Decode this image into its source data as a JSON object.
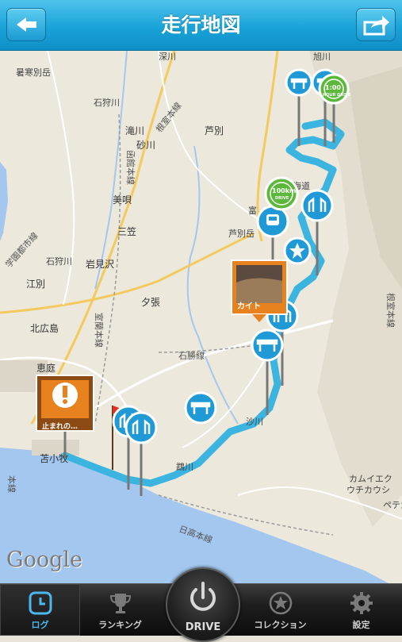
{
  "header": {
    "title": "走行地図",
    "back_icon": "back-arrow-icon",
    "share_icon": "share-icon"
  },
  "map": {
    "place_labels": [
      {
        "id": "fukagawa",
        "text": "深川"
      },
      {
        "id": "asahikawa",
        "text": "旭川"
      },
      {
        "id": "shokanbetsu",
        "text": "暑寒別岳"
      },
      {
        "id": "ishikarigawa",
        "text": "石狩川"
      },
      {
        "id": "takikawa",
        "text": "滝川"
      },
      {
        "id": "sunagawa",
        "text": "砂川"
      },
      {
        "id": "ashibetsu",
        "text": "芦別"
      },
      {
        "id": "bibai",
        "text": "美唄"
      },
      {
        "id": "mikasa",
        "text": "三笠"
      },
      {
        "id": "ashibetsudake",
        "text": "芦別岳"
      },
      {
        "id": "iwamizawa",
        "text": "岩見沢"
      },
      {
        "id": "ishikarigawa2",
        "text": "石狩川"
      },
      {
        "id": "ebetsu",
        "text": "江別"
      },
      {
        "id": "yubari",
        "text": "夕張"
      },
      {
        "id": "kitahiroshima",
        "text": "北広島"
      },
      {
        "id": "eniwa",
        "text": "恵庭"
      },
      {
        "id": "tomakomai",
        "text": "苫小牧"
      },
      {
        "id": "mukawa",
        "text": "鵡川"
      },
      {
        "id": "kamuiekuuchikaushi1",
        "text": "カムイエク"
      },
      {
        "id": "kamuiekuuchikaushi2",
        "text": "ウチカウシ"
      },
      {
        "id": "pebetsu",
        "text": "ペテガ"
      },
      {
        "id": "yuba",
        "text": "夕張"
      },
      {
        "id": "hokkaido",
        "text": "北海道"
      },
      {
        "id": "furano",
        "text": "富"
      },
      {
        "id": "saru",
        "text": "沙川"
      }
    ],
    "rail_labels": [
      {
        "id": "nemuro",
        "text": "根室本線"
      },
      {
        "id": "hakodate",
        "text": "函館本線"
      },
      {
        "id": "sasshou",
        "text": "学園都市線"
      },
      {
        "id": "muroran",
        "text": "室蘭本線"
      },
      {
        "id": "sekisho",
        "text": "石勝線"
      },
      {
        "id": "hidaka",
        "text": "日高本線"
      },
      {
        "id": "nemuro2",
        "text": "根室本線"
      },
      {
        "id": "honsen",
        "text": "本線"
      }
    ],
    "photo_pin": {
      "caption": "カイト"
    },
    "stop_pin": {
      "caption": "止まれの…"
    },
    "badges": {
      "hour": {
        "top": "1:00",
        "bottom": "HOUR DRIVE"
      },
      "km": {
        "top": "100",
        "unit": "km",
        "bottom": "DRIVE"
      }
    },
    "attribution": "Google",
    "route_color": "#3cb4e0",
    "water_color": "#a4c7f0"
  },
  "tabbar": {
    "tabs": [
      {
        "label": "ログ",
        "icon": "clock-icon",
        "active": true
      },
      {
        "label": "ランキング",
        "icon": "trophy-icon",
        "active": false
      },
      {
        "label": "DRIVE",
        "icon": "power-icon",
        "active": false
      },
      {
        "label": "コレクション",
        "icon": "star-badge-icon",
        "active": false
      },
      {
        "label": "設定",
        "icon": "gear-icon",
        "active": false
      }
    ]
  }
}
